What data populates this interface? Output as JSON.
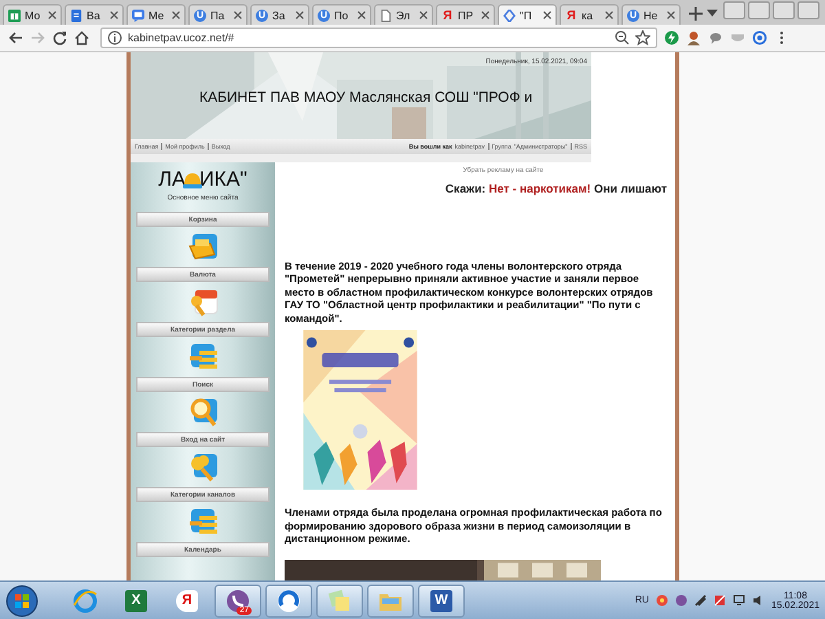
{
  "browser": {
    "tabs": [
      {
        "label": "Мо",
        "kind": "sheets",
        "selected": false
      },
      {
        "label": "Ва",
        "kind": "docs",
        "selected": false
      },
      {
        "label": "Ме",
        "kind": "chat",
        "selected": false
      },
      {
        "label": "Па",
        "kind": "round",
        "glyph": "U",
        "selected": false
      },
      {
        "label": "За",
        "kind": "round",
        "glyph": "U",
        "selected": false
      },
      {
        "label": "По",
        "kind": "round",
        "glyph": "U",
        "selected": false
      },
      {
        "label": "Эл",
        "kind": "file",
        "selected": false
      },
      {
        "label": "ПР",
        "kind": "letter",
        "glyph": "Я",
        "selected": false
      },
      {
        "label": "\"П",
        "kind": "diamond",
        "selected": true
      },
      {
        "label": "ка",
        "kind": "letter",
        "glyph": "Я",
        "selected": false
      },
      {
        "label": "Не",
        "kind": "round",
        "glyph": "U",
        "selected": false
      }
    ],
    "url": "kabinetpav.ucoz.net/#"
  },
  "site": {
    "date": "Понедельник, 15.02.2021, 09:04",
    "title": "КАБИНЕТ ПАВ МАОУ Маслянская СОШ \"ПРОФ и",
    "nav": [
      "Главная",
      "Мой профиль",
      "Выход"
    ],
    "user": {
      "prefix": "Вы вошли как",
      "name": "kabinetpav",
      "group_prefix": "Группа",
      "group": "\"Администраторы\"",
      "rss": "RSS"
    },
    "sidebar": {
      "logo_left": "ЛА",
      "logo_right": "ИКА\"",
      "menu_label": "Основное меню сайта",
      "blocks": [
        {
          "title": "Корзина",
          "kind": "basket"
        },
        {
          "title": "Валюта",
          "kind": "currency"
        },
        {
          "title": "Категории раздела",
          "kind": "list"
        },
        {
          "title": "Поиск",
          "kind": "search"
        },
        {
          "title": "Вход на сайт",
          "kind": "key"
        },
        {
          "title": "Категории каналов",
          "kind": "list"
        },
        {
          "title": "Календарь",
          "kind": "header"
        }
      ]
    },
    "content": {
      "ad_link": "Убрать рекламу на сайте",
      "slogan": [
        {
          "text": "Скажи:",
          "kind": "plain"
        },
        {
          "text": "Нет -  наркотикам!",
          "kind": "accent"
        },
        {
          "text": "Они лишают",
          "kind": "plain"
        }
      ],
      "paragraphs": [
        "В течение 2019 - 2020 учебного года члены волонтерского отряда \"Прометей\" непрерывно  приняли  активное участие и заняли первое место в областном профилактическом конкурсе волонтерских отрядов  ГАУ ТО \"Областной центр профилактики и реабилитации\" \"По пути с командой\".",
        "Членами отряда была проделана огромная профилактическая работа по формированию здорового образа жизни  в период самоизоляции в дистанционном режиме."
      ]
    }
  },
  "taskbar": {
    "apps": [
      {
        "kind": "ie",
        "selected": false
      },
      {
        "kind": "excel",
        "glyph": "X",
        "selected": false
      },
      {
        "kind": "yandex",
        "glyph": "Я",
        "selected": false
      },
      {
        "kind": "viber",
        "badge": "27",
        "selected": true
      },
      {
        "kind": "swirl",
        "selected": true
      },
      {
        "kind": "notes",
        "selected": true
      },
      {
        "kind": "folder",
        "selected": true
      },
      {
        "kind": "word",
        "glyph": "W",
        "selected": true
      }
    ],
    "language": "RU",
    "time": "11:08",
    "date": "15.02.2021"
  }
}
